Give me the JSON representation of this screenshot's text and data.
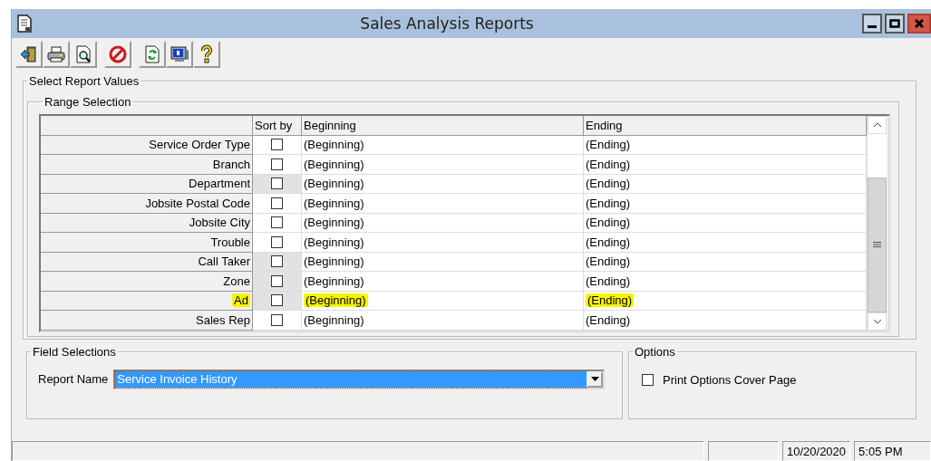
{
  "window": {
    "title": "Sales Analysis Reports"
  },
  "toolbar": {
    "groups": [
      [
        {
          "kind": "exit"
        },
        {
          "kind": "print"
        },
        {
          "kind": "preview"
        }
      ],
      [
        {
          "kind": "cancel"
        }
      ],
      [
        {
          "kind": "refresh"
        },
        {
          "kind": "display"
        },
        {
          "kind": "help"
        }
      ]
    ]
  },
  "select_report_values": {
    "title": "Select Report Values",
    "range_selection": {
      "title": "Range Selection",
      "columns": [
        "Sort by",
        "Beginning",
        "Ending"
      ],
      "rows": [
        {
          "label": "Service Order Type",
          "checked": false,
          "shaded": false,
          "highlighted": false,
          "beginning": "(Beginning)",
          "ending": "(Ending)"
        },
        {
          "label": "Branch",
          "checked": false,
          "shaded": false,
          "highlighted": false,
          "beginning": "(Beginning)",
          "ending": "(Ending)"
        },
        {
          "label": "Department",
          "checked": false,
          "shaded": true,
          "highlighted": false,
          "beginning": "(Beginning)",
          "ending": "(Ending)"
        },
        {
          "label": "Jobsite Postal Code",
          "checked": false,
          "shaded": false,
          "highlighted": false,
          "beginning": "(Beginning)",
          "ending": "(Ending)"
        },
        {
          "label": "Jobsite City",
          "checked": false,
          "shaded": false,
          "highlighted": false,
          "beginning": "(Beginning)",
          "ending": "(Ending)"
        },
        {
          "label": "Trouble",
          "checked": false,
          "shaded": false,
          "highlighted": false,
          "beginning": "(Beginning)",
          "ending": "(Ending)"
        },
        {
          "label": "Call Taker",
          "checked": false,
          "shaded": true,
          "highlighted": false,
          "beginning": "(Beginning)",
          "ending": "(Ending)"
        },
        {
          "label": "Zone",
          "checked": false,
          "shaded": true,
          "highlighted": false,
          "beginning": "(Beginning)",
          "ending": "(Ending)"
        },
        {
          "label": "Ad",
          "checked": false,
          "shaded": true,
          "highlighted": true,
          "beginning": "(Beginning)",
          "ending": "(Ending)"
        },
        {
          "label": "Sales Rep",
          "checked": false,
          "shaded": false,
          "highlighted": false,
          "beginning": "(Beginning)",
          "ending": "(Ending)"
        }
      ]
    }
  },
  "field_selections": {
    "title": "Field Selections",
    "report_name": {
      "label": "Report Name",
      "value": "Service Invoice History",
      "selected": true
    }
  },
  "options": {
    "title": "Options",
    "items": [
      {
        "label": "Print Options Cover Page",
        "checked": false
      }
    ]
  },
  "status_bar": {
    "date": "10/20/2020",
    "time": "5:05 PM"
  }
}
